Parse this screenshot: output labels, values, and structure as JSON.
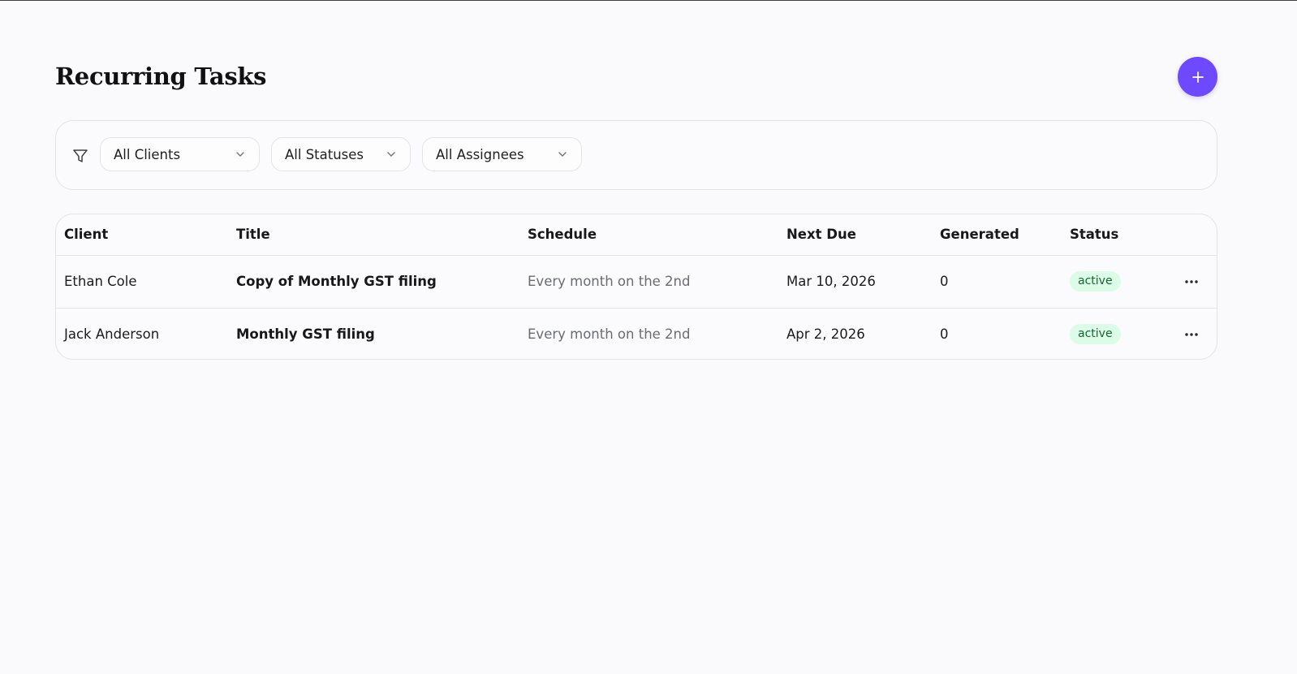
{
  "header": {
    "title": "Recurring Tasks",
    "add_button_icon": "plus-icon"
  },
  "filters": {
    "icon": "filter-icon",
    "clients": {
      "selected": "All Clients"
    },
    "statuses": {
      "selected": "All Statuses"
    },
    "assignees": {
      "selected": "All Assignees"
    }
  },
  "table": {
    "columns": {
      "client": "Client",
      "title": "Title",
      "schedule": "Schedule",
      "next_due": "Next Due",
      "generated": "Generated",
      "status": "Status"
    },
    "rows": [
      {
        "client": "Ethan Cole",
        "title": "Copy of Monthly GST filing",
        "schedule": "Every month on the 2nd",
        "next_due": "Mar 10, 2026",
        "generated": "0",
        "status": "active"
      },
      {
        "client": "Jack Anderson",
        "title": "Monthly GST filing",
        "schedule": "Every month on the 2nd",
        "next_due": "Apr 2, 2026",
        "generated": "0",
        "status": "active"
      }
    ],
    "row_action_icon": "more-horizontal-icon"
  },
  "colors": {
    "accent": "#6d4aff",
    "background": "#fafafc",
    "border": "#e4e4e7",
    "status_active_bg": "#dcfce7",
    "status_active_text": "#166534"
  }
}
